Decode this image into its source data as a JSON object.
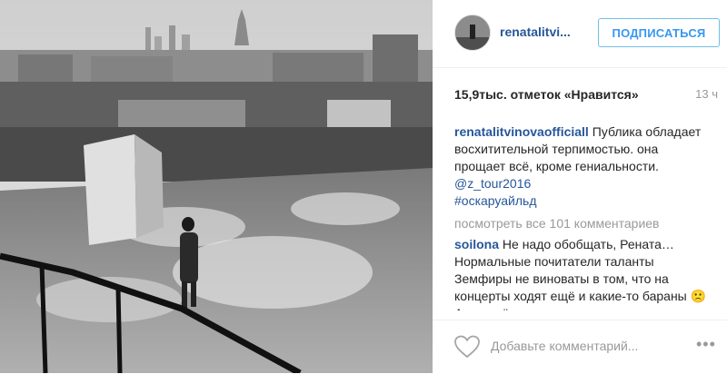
{
  "post": {
    "username": "renatalitvi...",
    "follow_label": "ПОДПИСАТЬСЯ",
    "likes": "15,9тыс. отметок «Нравится»",
    "time_ago": "13 ч"
  },
  "caption": {
    "author": "renatalitvinovaofficiall",
    "text": " Публика обладает восхитительной терпимостью. она прощает всё, кроме гениальности. ",
    "mention": "@z_tour2016",
    "hashtag": "#оскаруайльд"
  },
  "view_all": "посмотреть все 101 комментариев",
  "comment": {
    "author": "soilona",
    "text": " Не надо обобщать, Рената… Нормальные почитатели таланты Земфиры не виноваты в том, что на концерты ходят ещё и какие-то бараны 🙁 А недалёкие критики разлучают в"
  },
  "add_comment": {
    "placeholder": "Добавьте комментарий...",
    "more": "•••"
  },
  "icons": {
    "like": "heart-outline-icon",
    "more": "ellipsis-icon"
  }
}
